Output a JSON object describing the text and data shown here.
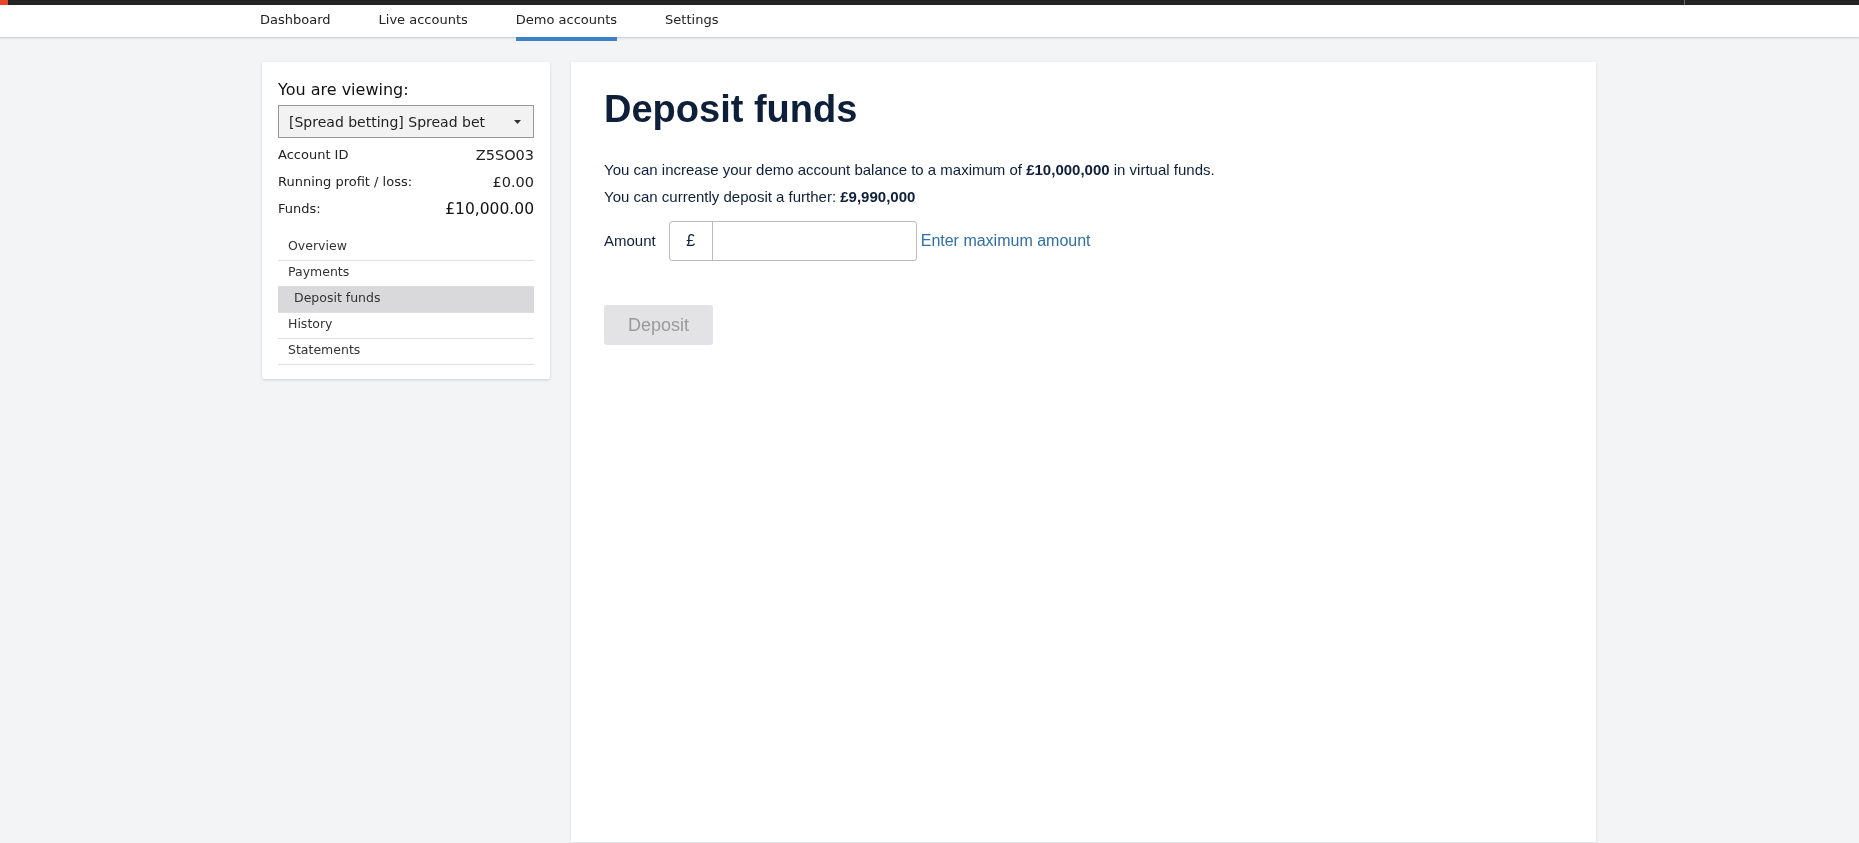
{
  "nav": {
    "tabs": [
      {
        "label": "Dashboard",
        "selected": false
      },
      {
        "label": "Live accounts",
        "selected": false
      },
      {
        "label": "Demo accounts",
        "selected": true
      },
      {
        "label": "Settings",
        "selected": false
      }
    ]
  },
  "sidebar": {
    "heading": "You are viewing:",
    "account_select": {
      "value": "[Spread betting] Spread bet"
    },
    "details": [
      {
        "label": "Account ID",
        "value": "Z5SO03",
        "bold": false
      },
      {
        "label": "Running profit / loss:",
        "value": "£0.00",
        "bold": false
      },
      {
        "label": "Funds:",
        "value": "£10,000.00",
        "bold": true
      }
    ],
    "menu": [
      {
        "label": "Overview",
        "selected": false
      },
      {
        "label": "Payments",
        "selected": false,
        "children": [
          {
            "label": "Deposit funds",
            "selected": true
          }
        ]
      },
      {
        "label": "History",
        "selected": false
      },
      {
        "label": "Statements",
        "selected": false
      }
    ]
  },
  "main": {
    "title": "Deposit funds",
    "paragraphs": [
      "You can increase your demo account balance to a maximum of **£10,000,000** in virtual funds.",
      "You can currently deposit a further: **£9,990,000**"
    ],
    "amount": {
      "label": "Amount",
      "currency": "£",
      "link": "Enter maximum amount"
    },
    "deposit_button": {
      "label": "Deposit",
      "disabled": true
    }
  }
}
